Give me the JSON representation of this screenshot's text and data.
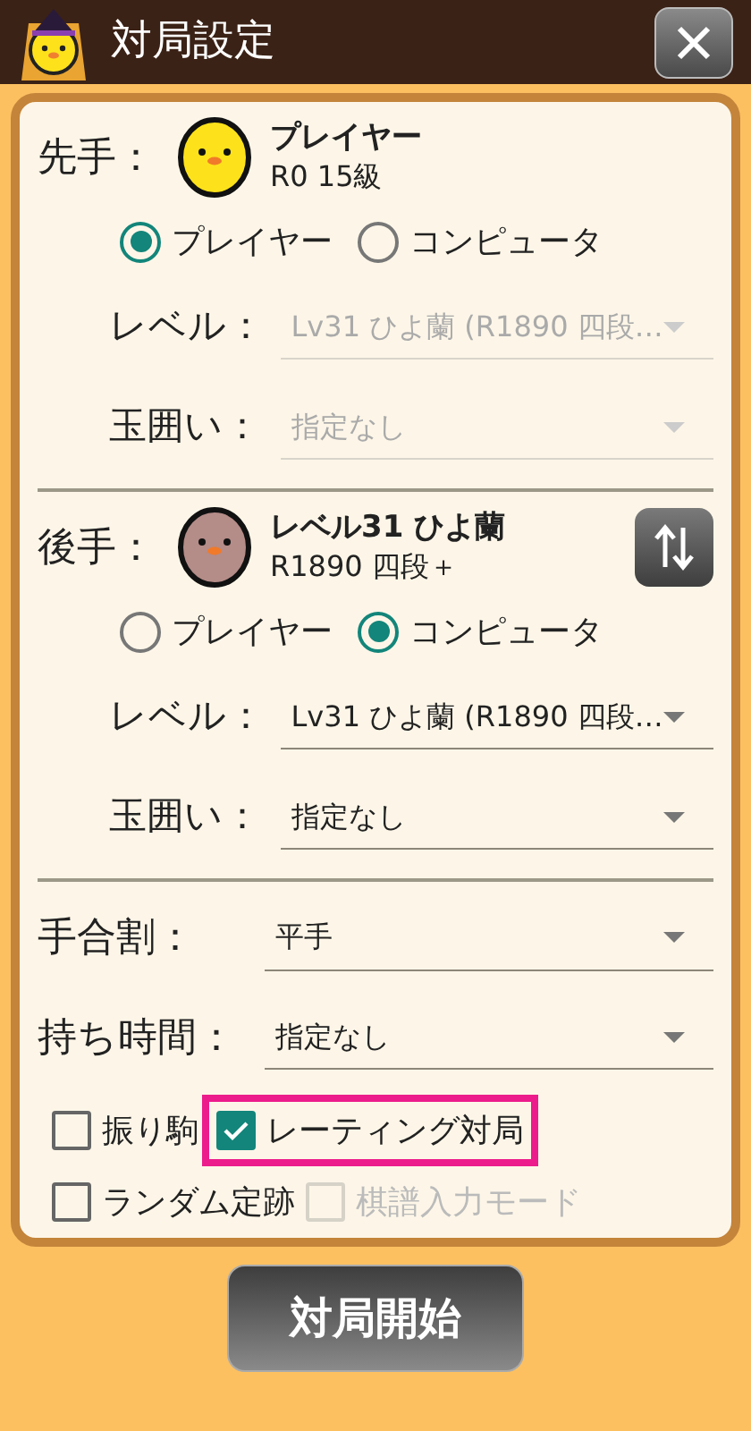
{
  "header": {
    "title": "対局設定"
  },
  "players": [
    {
      "role": "先手：",
      "kind": "human",
      "name": "プレイヤー",
      "rating": "R0 15級",
      "swap_button": false,
      "modes": [
        {
          "label": "プレイヤー",
          "selected": true
        },
        {
          "label": "コンピュータ",
          "selected": false
        }
      ],
      "fields": [
        {
          "label": "レベル：",
          "value": "Lv31 ひよ蘭 (R1890 四段…",
          "disabled": true
        },
        {
          "label": "玉囲い：",
          "value": "指定なし",
          "disabled": true
        }
      ]
    },
    {
      "role": "後手：",
      "kind": "computer",
      "name": "レベル31 ひよ蘭",
      "rating": "R1890 四段＋",
      "swap_button": true,
      "modes": [
        {
          "label": "プレイヤー",
          "selected": false
        },
        {
          "label": "コンピュータ",
          "selected": true
        }
      ],
      "fields": [
        {
          "label": "レベル：",
          "value": "Lv31 ひよ蘭 (R1890 四段…",
          "disabled": false
        },
        {
          "label": "玉囲い：",
          "value": "指定なし",
          "disabled": false
        }
      ]
    }
  ],
  "settings": [
    {
      "label": "手合割：",
      "value": "平手"
    },
    {
      "label": "持ち時間：",
      "value": "指定なし"
    }
  ],
  "options": [
    {
      "label": "振り駒",
      "checked": false,
      "disabled": false,
      "highlighted": false
    },
    {
      "label": "レーティング対局",
      "checked": true,
      "disabled": false,
      "highlighted": true
    },
    {
      "label": "ランダム定跡",
      "checked": false,
      "disabled": false,
      "highlighted": false
    },
    {
      "label": "棋譜入力モード",
      "checked": false,
      "disabled": true,
      "highlighted": false
    }
  ],
  "start_button": "対局開始"
}
